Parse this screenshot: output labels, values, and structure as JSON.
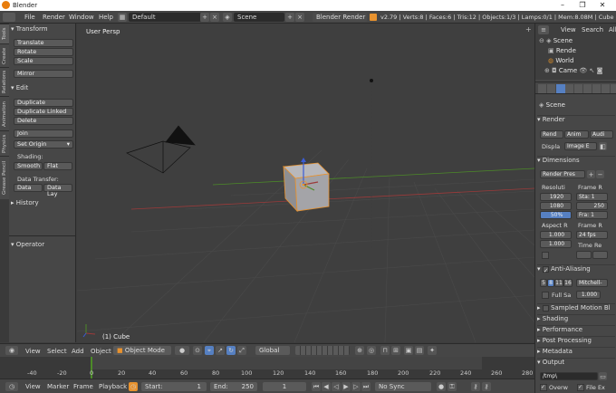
{
  "window": {
    "title": "Blender",
    "controls": [
      "–",
      "❐",
      "✕"
    ]
  },
  "topbar": {
    "menus": [
      "File",
      "Render",
      "Window",
      "Help"
    ],
    "screen_layout": "Default",
    "scene": "Scene",
    "engine": "Blender Render",
    "stats": "v2.79 | Verts:8 | Faces:6 | Tris:12 | Objects:1/3 | Lamps:0/1 | Mem:8.08M | Cube"
  },
  "toolshelf": {
    "tabs": [
      "Tools",
      "Create",
      "Relations",
      "Animation",
      "Physics",
      "Grease Pencil"
    ],
    "transform": {
      "title": "Transform",
      "buttons": [
        "Translate",
        "Rotate",
        "Scale",
        "Mirror"
      ]
    },
    "edit": {
      "title": "Edit",
      "buttons": [
        "Duplicate",
        "Duplicate Linked",
        "Delete",
        "Join",
        "Set Origin"
      ]
    },
    "shading": {
      "label": "Shading:",
      "smooth": "Smooth",
      "flat": "Flat"
    },
    "data_transfer": {
      "label": "Data Transfer:",
      "data": "Data",
      "data_lay": "Data Lay"
    },
    "history": "History",
    "operator": "Operator"
  },
  "viewport": {
    "view_label": "User Persp",
    "object_label": "(1) Cube"
  },
  "view3d_header": {
    "menus": [
      "View",
      "Select",
      "Add",
      "Object"
    ],
    "mode": "Object Mode",
    "orientation": "Global"
  },
  "timeline": {
    "ticks": [
      "-40",
      "-20",
      "0",
      "20",
      "40",
      "60",
      "80",
      "100",
      "120",
      "140",
      "160",
      "180",
      "200",
      "220",
      "240",
      "260",
      "280"
    ],
    "current_frame_value": 0
  },
  "timeline_header": {
    "menus": [
      "View",
      "Marker",
      "Frame",
      "Playback"
    ],
    "start_label": "Start:",
    "start": "1",
    "end_label": "End:",
    "end": "250",
    "current": "1",
    "sync": "No Sync"
  },
  "outliner": {
    "menus": [
      "View",
      "Search",
      "All"
    ],
    "items": [
      "Scene",
      "Rende",
      "World",
      "Came"
    ]
  },
  "properties": {
    "scene_label": "Scene",
    "render_title": "Render",
    "render_buttons": [
      "Rend",
      "Anim",
      "Audi"
    ],
    "display_label": "Displa",
    "display_value": "Image E",
    "dimensions_title": "Dimensions",
    "presets": "Render Pres",
    "resolution_label": "Resoluti",
    "res_x": "1920",
    "res_y": "1080",
    "res_pct": "50%",
    "frame_range_label": "Frame R",
    "sta": "Sta: 1",
    "end": "250",
    "fra": "Fra: 1",
    "aspect_label": "Aspect R",
    "aspect_x": "1.000",
    "aspect_y": "1.000",
    "framerate_label": "Frame R",
    "fps": "24 fps",
    "time_label": "Time Re",
    "aa_title": "Anti-Aliasing",
    "aa_samples": [
      "5",
      "8",
      "11",
      "16"
    ],
    "aa_filter": "Mitchell-",
    "full_sample": "Full Sa",
    "filter_size": "1.000",
    "collapsed": [
      "Sampled Motion Bl",
      "Shading",
      "Performance",
      "Post Processing",
      "Metadata",
      "Output"
    ],
    "output_path": "/tmp\\",
    "overwrite": "Overw",
    "file_ext": "File Ex"
  },
  "colors": {
    "accent": "#5680c2",
    "selected_outline": "#e8922e",
    "x_axis": "#9b3a3a",
    "y_axis": "#4c8a28"
  }
}
